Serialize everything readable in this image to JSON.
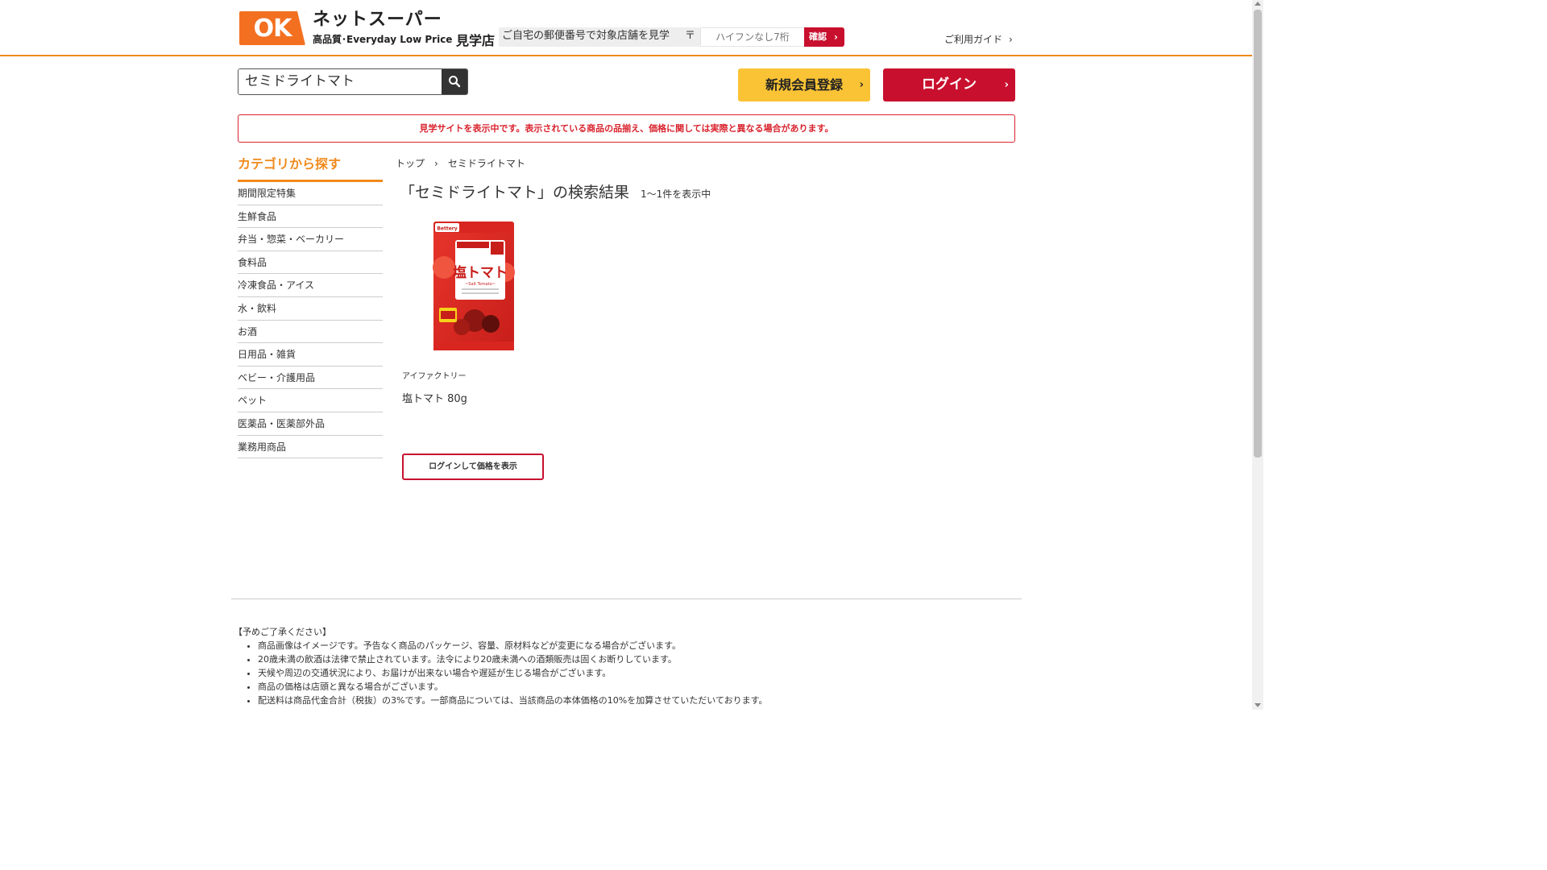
{
  "header": {
    "logo_text": "OK",
    "brand_main": "ネットスーパー",
    "brand_sub": "高品質･Everyday Low Price",
    "store_label": "見学店",
    "zip_prompt": "ご自宅の郵便番号で対象店舗を見学",
    "zip_mark": "〒",
    "zip_placeholder": "ハイフンなし7桁",
    "zip_button": "確認",
    "guide_link": "ご利用ガイド"
  },
  "search": {
    "value": "セミドライトマト"
  },
  "account": {
    "register_label": "新規会員登録",
    "login_label": "ログイン"
  },
  "notice": "見学サイトを表示中です。表示されている商品の品揃え、価格に関しては実際と異なる場合があります。",
  "sidebar": {
    "title": "カテゴリから探す",
    "categories": [
      "期間限定特集",
      "生鮮食品",
      "弁当・惣菜・ベーカリー",
      "食料品",
      "冷凍食品・アイス",
      "水・飲料",
      "お酒",
      "日用品・雑貨",
      "ベビー・介護用品",
      "ペット",
      "医薬品・医薬部外品",
      "業務用商品"
    ]
  },
  "breadcrumb": {
    "home": "トップ",
    "separator": "›",
    "current": "セミドライトマト"
  },
  "results": {
    "title": "「セミドライトマト」の検索結果",
    "count": "1～1件を表示中"
  },
  "product": {
    "maker": "アイファクトリー",
    "name": "塩トマト 80g",
    "price_button": "ログインして価格を表示",
    "package_brand": "Bettery",
    "package_title": "塩トマト",
    "package_subtitle": "~Salt Tomato~"
  },
  "footer": {
    "title": "【予めご了承ください】",
    "items": [
      "商品画像はイメージです。予告なく商品のパッケージ、容量、原材料などが変更になる場合がございます。",
      "20歳未満の飲酒は法律で禁止されています。法令により20歳未満への酒類販売は固くお断りしています。",
      "天候や周辺の交通状況により、お届けが出来ない場合や遅延が生じる場合がございます。",
      "商品の価格は店頭と異なる場合がございます。",
      "配送料は商品代金合計（税抜）の3%です。一部商品については、当該商品の本体価格の10%を加算させていただいております。"
    ]
  },
  "colors": {
    "brand_orange": "#f08a1c",
    "accent_red": "#c8102e",
    "register_yellow": "#f9c335"
  }
}
